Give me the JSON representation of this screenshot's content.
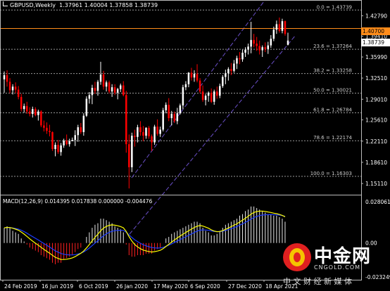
{
  "header": {
    "symbol": "GBPUSD,Weekly",
    "open": "1.37961",
    "high": "1.40004",
    "low": "1.37858",
    "close": "1.38739"
  },
  "price_axis": {
    "ticks": [
      "1.42790",
      "1.39410",
      "1.35990",
      "1.32510",
      "1.29010",
      "1.25610",
      "1.22110",
      "1.18610",
      "1.15110"
    ],
    "current_line_label": "1.40700",
    "current_price_label": "1.38739"
  },
  "fibonacci": {
    "levels": [
      {
        "label": "0.0 = 1.43739",
        "value": 1.43739
      },
      {
        "label": "23.6 = 1.37264",
        "value": 1.37264
      },
      {
        "label": "38.2 = 1.33258",
        "value": 1.33258
      },
      {
        "label": "50.0 = 1.30021",
        "value": 1.30021
      },
      {
        "label": "61.8 = 1.26784",
        "value": 1.26784
      },
      {
        "label": "78.6 = 1.22174",
        "value": 1.22174
      },
      {
        "label": "100.0 = 1.16303",
        "value": 1.16303
      }
    ]
  },
  "macd": {
    "header": "MACD(12,26,9) 0.014395 0.017838 0.000000 -0.004476",
    "axis_top": "0.028061",
    "axis_zero": "0.00",
    "axis_bottom": "-0.023249"
  },
  "time_axis": {
    "labels": [
      "24 Feb 2019",
      "16 Jun 2019",
      "6 Oct 2019",
      "26 Jan 2020",
      "17 May 2020",
      "6 Sep 2020",
      "27 Dec 2020",
      "18 Apr 2021"
    ]
  },
  "watermark": {
    "brand_cn": "中金网",
    "domain": "CNGOLD.COM",
    "slogan": "中 文 财 经 新 媒 体"
  },
  "colors": {
    "background": "#000000",
    "bull_candle": "#ffffff",
    "bear_candle": "#ff0000",
    "fib_line": "#9a9a9a",
    "channel": "#6a4fc8",
    "current_line": "#ff8c1a",
    "macd_signal": "#ffff00",
    "macd_line": "#1e3cff",
    "watermark_red": "#e02020"
  },
  "chart_data": {
    "type": "candlestick",
    "timeframe": "Weekly",
    "symbol": "GBPUSD",
    "ylim": [
      1.135,
      1.44
    ],
    "x_labels": [
      "24 Feb 2019",
      "16 Jun 2019",
      "6 Oct 2019",
      "26 Jan 2020",
      "17 May 2020",
      "6 Sep 2020",
      "27 Dec 2020",
      "18 Apr 2021"
    ],
    "candles": [
      [
        1.323,
        1.336,
        1.301,
        1.33
      ],
      [
        1.33,
        1.338,
        1.311,
        1.319
      ],
      [
        1.319,
        1.325,
        1.3,
        1.305
      ],
      [
        1.305,
        1.315,
        1.298,
        1.311
      ],
      [
        1.311,
        1.318,
        1.3,
        1.306
      ],
      [
        1.306,
        1.312,
        1.29,
        1.294
      ],
      [
        1.294,
        1.299,
        1.27,
        1.274
      ],
      [
        1.274,
        1.283,
        1.268,
        1.279
      ],
      [
        1.279,
        1.286,
        1.266,
        1.27
      ],
      [
        1.27,
        1.277,
        1.262,
        1.266
      ],
      [
        1.266,
        1.278,
        1.26,
        1.274
      ],
      [
        1.274,
        1.277,
        1.262,
        1.264
      ],
      [
        1.264,
        1.273,
        1.255,
        1.27
      ],
      [
        1.27,
        1.272,
        1.244,
        1.247
      ],
      [
        1.247,
        1.255,
        1.237,
        1.243
      ],
      [
        1.243,
        1.252,
        1.233,
        1.238
      ],
      [
        1.238,
        1.248,
        1.229,
        1.236
      ],
      [
        1.236,
        1.237,
        1.205,
        1.208
      ],
      [
        1.208,
        1.219,
        1.196,
        1.215
      ],
      [
        1.215,
        1.223,
        1.2,
        1.203
      ],
      [
        1.203,
        1.218,
        1.197,
        1.214
      ],
      [
        1.214,
        1.225,
        1.21,
        1.222
      ],
      [
        1.222,
        1.232,
        1.214,
        1.216
      ],
      [
        1.216,
        1.225,
        1.212,
        1.221
      ],
      [
        1.221,
        1.227,
        1.221,
        1.223
      ],
      [
        1.223,
        1.239,
        1.213,
        1.231
      ],
      [
        1.231,
        1.248,
        1.22,
        1.244
      ],
      [
        1.244,
        1.251,
        1.233,
        1.236
      ],
      [
        1.236,
        1.267,
        1.23,
        1.263
      ],
      [
        1.263,
        1.295,
        1.261,
        1.291
      ],
      [
        1.291,
        1.302,
        1.283,
        1.297
      ],
      [
        1.297,
        1.314,
        1.282,
        1.309
      ],
      [
        1.309,
        1.319,
        1.299,
        1.304
      ],
      [
        1.304,
        1.322,
        1.296,
        1.319
      ],
      [
        1.319,
        1.352,
        1.314,
        1.331
      ],
      [
        1.331,
        1.337,
        1.306,
        1.311
      ],
      [
        1.311,
        1.321,
        1.303,
        1.318
      ],
      [
        1.318,
        1.321,
        1.3,
        1.303
      ],
      [
        1.303,
        1.315,
        1.294,
        1.31
      ],
      [
        1.31,
        1.315,
        1.297,
        1.301
      ],
      [
        1.301,
        1.309,
        1.29,
        1.307
      ],
      [
        1.307,
        1.316,
        1.302,
        1.313
      ],
      [
        1.313,
        1.32,
        1.295,
        1.297
      ],
      [
        1.297,
        1.304,
        1.202,
        1.216
      ],
      [
        1.216,
        1.232,
        1.143,
        1.178
      ],
      [
        1.178,
        1.235,
        1.17,
        1.23
      ],
      [
        1.23,
        1.24,
        1.212,
        1.228
      ],
      [
        1.228,
        1.248,
        1.219,
        1.244
      ],
      [
        1.244,
        1.254,
        1.23,
        1.236
      ],
      [
        1.236,
        1.246,
        1.221,
        1.23
      ],
      [
        1.23,
        1.244,
        1.225,
        1.243
      ],
      [
        1.243,
        1.246,
        1.225,
        1.229
      ],
      [
        1.229,
        1.232,
        1.205,
        1.219
      ],
      [
        1.219,
        1.248,
        1.215,
        1.245
      ],
      [
        1.245,
        1.257,
        1.23,
        1.233
      ],
      [
        1.233,
        1.245,
        1.228,
        1.24
      ],
      [
        1.24,
        1.276,
        1.237,
        1.272
      ],
      [
        1.272,
        1.285,
        1.267,
        1.281
      ],
      [
        1.281,
        1.292,
        1.254,
        1.259
      ],
      [
        1.259,
        1.271,
        1.247,
        1.266
      ],
      [
        1.266,
        1.27,
        1.251,
        1.254
      ],
      [
        1.254,
        1.276,
        1.249,
        1.267
      ],
      [
        1.267,
        1.283,
        1.265,
        1.28
      ],
      [
        1.28,
        1.314,
        1.274,
        1.31
      ],
      [
        1.31,
        1.32,
        1.305,
        1.315
      ],
      [
        1.315,
        1.335,
        1.31,
        1.334
      ],
      [
        1.334,
        1.342,
        1.321,
        1.326
      ],
      [
        1.326,
        1.338,
        1.319,
        1.332
      ],
      [
        1.332,
        1.348,
        1.318,
        1.321
      ],
      [
        1.321,
        1.325,
        1.3,
        1.303
      ],
      [
        1.303,
        1.313,
        1.286,
        1.289
      ],
      [
        1.289,
        1.299,
        1.28,
        1.296
      ],
      [
        1.296,
        1.303,
        1.286,
        1.301
      ],
      [
        1.301,
        1.308,
        1.284,
        1.286
      ],
      [
        1.286,
        1.306,
        1.281,
        1.303
      ],
      [
        1.303,
        1.311,
        1.291,
        1.296
      ],
      [
        1.296,
        1.316,
        1.292,
        1.312
      ],
      [
        1.312,
        1.33,
        1.309,
        1.327
      ],
      [
        1.327,
        1.339,
        1.315,
        1.333
      ],
      [
        1.333,
        1.343,
        1.321,
        1.34
      ],
      [
        1.34,
        1.35,
        1.33,
        1.337
      ],
      [
        1.337,
        1.355,
        1.334,
        1.349
      ],
      [
        1.349,
        1.362,
        1.34,
        1.358
      ],
      [
        1.358,
        1.368,
        1.348,
        1.356
      ],
      [
        1.356,
        1.372,
        1.352,
        1.367
      ],
      [
        1.367,
        1.376,
        1.36,
        1.372
      ],
      [
        1.372,
        1.382,
        1.364,
        1.377
      ],
      [
        1.377,
        1.418,
        1.366,
        1.388
      ],
      [
        1.388,
        1.398,
        1.376,
        1.382
      ],
      [
        1.382,
        1.393,
        1.37,
        1.378
      ],
      [
        1.378,
        1.387,
        1.364,
        1.371
      ],
      [
        1.371,
        1.379,
        1.36,
        1.376
      ],
      [
        1.376,
        1.384,
        1.368,
        1.373
      ],
      [
        1.373,
        1.385,
        1.365,
        1.379
      ],
      [
        1.379,
        1.396,
        1.375,
        1.39
      ],
      [
        1.39,
        1.41,
        1.386,
        1.405
      ],
      [
        1.405,
        1.42,
        1.398,
        1.414
      ],
      [
        1.414,
        1.425,
        1.4,
        1.403
      ],
      [
        1.403,
        1.423,
        1.399,
        1.419
      ],
      [
        1.419,
        1.42,
        1.395,
        1.398
      ],
      [
        1.38,
        1.4,
        1.379,
        1.387
      ]
    ],
    "fib_levels": [
      {
        "ratio": 0.0,
        "price": 1.43739
      },
      {
        "ratio": 23.6,
        "price": 1.37264
      },
      {
        "ratio": 38.2,
        "price": 1.33258
      },
      {
        "ratio": 50.0,
        "price": 1.30021
      },
      {
        "ratio": 61.8,
        "price": 1.26784
      },
      {
        "ratio": 78.6,
        "price": 1.22174
      },
      {
        "ratio": 100.0,
        "price": 1.16303
      }
    ],
    "horizontal_line": 1.407,
    "macd": {
      "params": "12,26,9",
      "ylim": [
        -0.023249,
        0.028061
      ],
      "histogram": [
        0.01,
        0.011,
        0.01,
        0.008,
        0.007,
        0.006,
        0.003,
        0.001,
        -0.001,
        -0.003,
        -0.004,
        -0.005,
        -0.006,
        -0.008,
        -0.009,
        -0.01,
        -0.011,
        -0.013,
        -0.014,
        -0.013,
        -0.013,
        -0.011,
        -0.01,
        -0.009,
        -0.008,
        -0.006,
        -0.004,
        -0.003,
        0.0,
        0.004,
        0.007,
        0.01,
        0.012,
        0.013,
        0.016,
        0.016,
        0.015,
        0.014,
        0.013,
        0.011,
        0.01,
        0.009,
        0.007,
        -0.001,
        -0.008,
        -0.009,
        -0.009,
        -0.008,
        -0.008,
        -0.008,
        -0.007,
        -0.007,
        -0.007,
        -0.005,
        -0.004,
        -0.003,
        0.0,
        0.003,
        0.004,
        0.006,
        0.007,
        0.008,
        0.009,
        0.01,
        0.011,
        0.012,
        0.013,
        0.014,
        0.014,
        0.013,
        0.01,
        0.008,
        0.007,
        0.005,
        0.005,
        0.006,
        0.008,
        0.01,
        0.012,
        0.013,
        0.014,
        0.015,
        0.016,
        0.018,
        0.019,
        0.021,
        0.022,
        0.024,
        0.024,
        0.023,
        0.022,
        0.021,
        0.02,
        0.019,
        0.019,
        0.018,
        0.018,
        0.017,
        0.016,
        0.014
      ]
    }
  }
}
